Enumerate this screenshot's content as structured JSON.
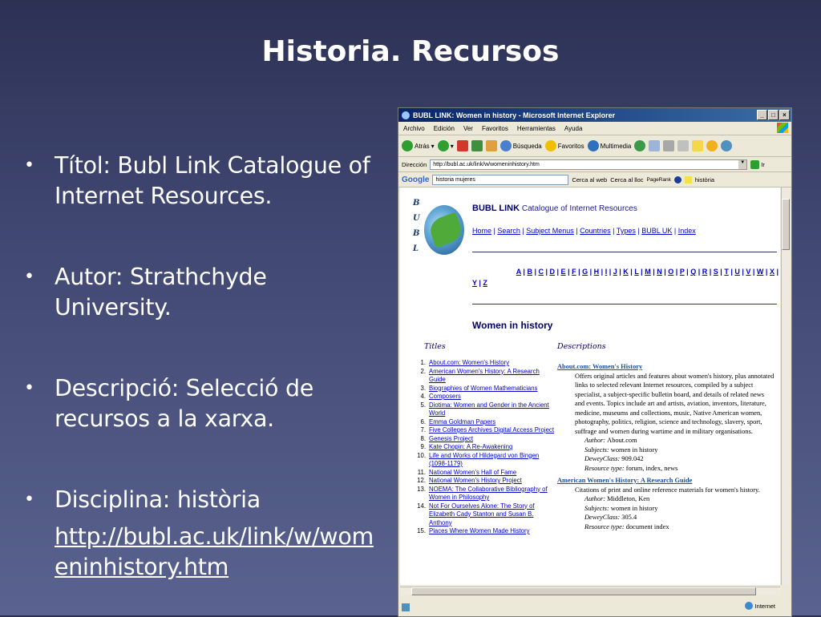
{
  "slide": {
    "title": "Historia. Recursos",
    "bullets": [
      {
        "text": "Títol: Bubl Link Catalogue of Internet Resources."
      },
      {
        "text": "Autor: Strathchyde University."
      },
      {
        "text": "Descripció: Selecció de recursos a la xarxa."
      },
      {
        "text": "Disciplina: història",
        "link": "http://bubl.ac.uk/link/w/womeninhistory.htm"
      }
    ]
  },
  "browser": {
    "window_title": "BUBL LINK: Women in history - Microsoft Internet Explorer",
    "menu": [
      "Archivo",
      "Edición",
      "Ver",
      "Favoritos",
      "Herramientas",
      "Ayuda"
    ],
    "toolbar": {
      "back": "Atrás",
      "search": "Búsqueda",
      "favorites": "Favoritos",
      "multimedia": "Multimedia"
    },
    "address_label": "Dirección",
    "address_value": "http://bubl.ac.uk/link/w/womeninhistory.htm",
    "go_label": "Ir",
    "google": {
      "logo": "Google",
      "query": "historia mujeres",
      "search_web": "Cerca al web",
      "search_site": "Cerca al lloc",
      "pagerank": "PageRank",
      "history": "història"
    },
    "status": {
      "zone": "Internet"
    },
    "colors": {
      "titlebar": "#0a246a",
      "link": "#0000cc",
      "heading": "#000066"
    }
  },
  "page": {
    "side_letters": [
      "B",
      "U",
      "B",
      "L"
    ],
    "brand": "BUBL LINK",
    "brand_tagline": "Catalogue of Internet Resources",
    "nav": [
      "Home",
      "Search",
      "Subject Menus",
      "Countries",
      "Types",
      "BUBL UK",
      "Index"
    ],
    "alphabet_line1": [
      "A",
      "B",
      "C",
      "D",
      "E",
      "F",
      "G",
      "H",
      "I",
      "J",
      "K",
      "L",
      "M",
      "N",
      "O",
      "P",
      "Q",
      "R",
      "S",
      "T",
      "U",
      "V",
      "W",
      "X"
    ],
    "alphabet_line2": [
      "Y",
      "Z"
    ],
    "heading": "Women in history",
    "titles_header": "Titles",
    "descriptions_header": "Descriptions",
    "titles": [
      {
        "n": "1.",
        "t": "About.com: Women's History"
      },
      {
        "n": "2.",
        "t": "American Women's History: A Research Guide"
      },
      {
        "n": "3.",
        "t": "Biographies of Women Mathematicians"
      },
      {
        "n": "4.",
        "t": "Composers"
      },
      {
        "n": "5.",
        "t": "Diotima: Women and Gender in the Ancient World"
      },
      {
        "n": "6.",
        "t": "Emma Goldman Papers"
      },
      {
        "n": "7.",
        "t": "Five Colleges Archives Digital Access Project"
      },
      {
        "n": "8.",
        "t": "Genesis Project"
      },
      {
        "n": "9.",
        "t": "Kate Chopin: A Re-Awakening"
      },
      {
        "n": "10.",
        "t": "Life and Works of Hildegard von Bingen (1098-1179)"
      },
      {
        "n": "11.",
        "t": "National Women's Hall of Fame"
      },
      {
        "n": "12.",
        "t": "National Women's History Project"
      },
      {
        "n": "13.",
        "t": "NOEMA: The Collaborative Bibliography of Women in Philosophy"
      },
      {
        "n": "14.",
        "t": "Not For Ourselves Alone: The Story of Elizabeth Cady Stanton and Susan B. Anthony"
      },
      {
        "n": "15.",
        "t": "Places Where Women Made History"
      }
    ],
    "descriptions": [
      {
        "title": "About.com: Women's History",
        "body": "Offers original articles and features about women's history, plus annotated links to selected relevant Internet resources, compiled by a subject specialist, a subject-specific bulletin board, and details of related news and events. Topics include art and artists, aviation, inventors, literature, medicine, museums and collections, music, Native American women, photography, politics, religion, science and technology, slavery, sport, suffrage and women during wartime and in military organisations.",
        "author_label": "Author:",
        "author": "About.com",
        "subjects_label": "Subjects:",
        "subjects": "women in history",
        "dewey_label": "DeweyClass:",
        "dewey": "909.042",
        "type_label": "Resource type:",
        "type": "forum, index, news"
      },
      {
        "title": "American Women's History: A Research Guide",
        "body": "Citations of print and online reference materials for women's history.",
        "author_label": "Author:",
        "author": "Middleton, Ken",
        "subjects_label": "Subjects:",
        "subjects": "women in history",
        "dewey_label": "DeweyClass:",
        "dewey": "305.4",
        "type_label": "Resource type:",
        "type": "document index"
      }
    ]
  }
}
